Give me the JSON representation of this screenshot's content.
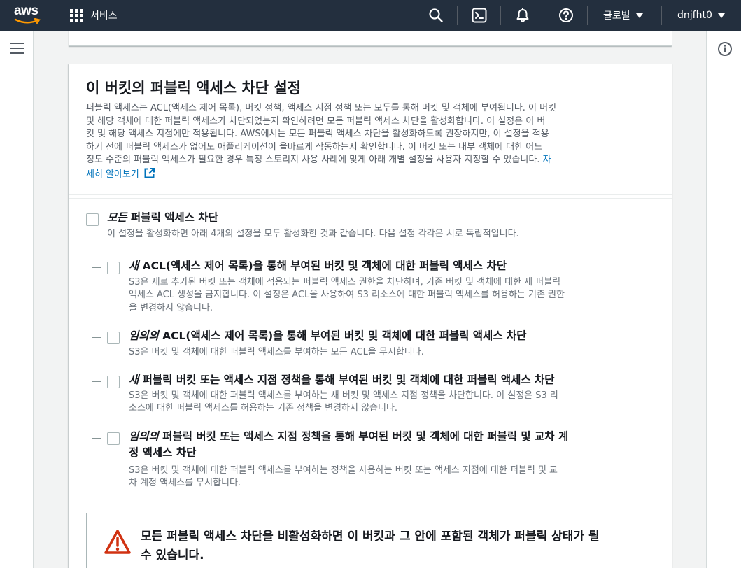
{
  "topnav": {
    "logo_text": "aws",
    "services_label": "서비스",
    "region_label": "글로벌",
    "account_label": "dnjfht0"
  },
  "colors": {
    "nav_bg": "#232f3e",
    "accent_orange": "#ff9900",
    "link": "#0073bb",
    "warning_red": "#d13212"
  },
  "section": {
    "title": "이 버킷의 퍼블릭 액세스 차단 설정",
    "desc_lines": [
      "퍼블릭 액세스는 ACL(액세스 제어 목록), 버킷 정책, 액세스 지점 정책 또는 모두를 통해 버킷 및 객체에 부여됩니다. 이 버킷",
      "및 해당 객체에 대한 퍼블릭 액세스가 차단되었는지 확인하려면 모든 퍼블릭 액세스 차단을 활성화합니다. 이 설정은 이 버",
      "킷 및 해당 액세스 지점에만 적용됩니다. AWS에서는 모든 퍼블릭 액세스 차단을 활성화하도록 권장하지만, 이 설정을 적용",
      "하기 전에 퍼블릭 액세스가 없어도 애플리케이션이 올바르게 작동하는지 확인합니다. 이 버킷 또는 내부 객체에 대한 어느",
      "정도 수준의 퍼블릭 액세스가 필요한 경우 특정 스토리지 사용 사례에 맞게 아래 개별 설정을 사용자 지정할 수 있습니다."
    ],
    "link_part1": " 자",
    "link_part2": "세히 알아보기"
  },
  "options": [
    {
      "emph": "모든",
      "title": " 퍼블릭 액세스 차단",
      "title2": "",
      "desc": [
        "이 설정을 활성화하면 아래 4개의 설정을 모두 활성화한 것과 같습니다. 다음 설정 각각은 서로 독립적입니다."
      ],
      "checked": false
    },
    {
      "emph": "새",
      "title": " ACL(액세스 제어 목록)을 통해 부여된 버킷 및 객체에 대한 퍼블릭 액세스 차단",
      "title2": "",
      "desc": [
        "S3은 새로 추가된 버킷 또는 객체에 적용되는 퍼블릭 액세스 권한을 차단하며, 기존 버킷 및 객체에 대한 새 퍼블릭",
        "액세스 ACL 생성을 금지합니다. 이 설정은 ACL을 사용하여 S3 리소스에 대한 퍼블릭 액세스를 허용하는 기존 권한",
        "을 변경하지 않습니다."
      ],
      "checked": false
    },
    {
      "emph": "임의의",
      "title": " ACL(액세스 제어 목록)을 통해 부여된 버킷 및 객체에 대한 퍼블릭 액세스 차단",
      "title2": "",
      "desc": [
        "S3은 버킷 및 객체에 대한 퍼블릭 액세스를 부여하는 모든 ACL을 무시합니다."
      ],
      "checked": false
    },
    {
      "emph": "새",
      "title": " 퍼블릭 버킷 또는 액세스 지점 정책을 통해 부여된 버킷 및 객체에 대한 퍼블릭 액세스 차단",
      "title2": "",
      "desc": [
        "S3은 버킷 및 객체에 대한 퍼블릭 액세스를 부여하는 새 버킷 및 액세스 지점 정책을 차단합니다. 이 설정은 S3 리",
        "소스에 대한 퍼블릭 액세스를 허용하는 기존 정책을 변경하지 않습니다."
      ],
      "checked": false
    },
    {
      "emph": "임의의",
      "title": " 퍼블릭 버킷 또는 액세스 지점 정책을 통해 부여된 버킷 및 객체에 대한 퍼블릭 및 교차 계",
      "title2": "정 액세스 차단",
      "desc": [
        "S3은 버킷 및 객체에 대한 퍼블릭 액세스를 부여하는 정책을 사용하는 버킷 또는 액세스 지점에 대한 퍼블릭 및 교",
        "차 계정 액세스를 무시합니다."
      ],
      "checked": false
    }
  ],
  "warning": {
    "line1": "모든 퍼블릭 액세스 차단을 비활성화하면 이 버킷과 그 안에 포함된 객체가 퍼블릭 상태가 될",
    "line2": "수 있습니다."
  },
  "icons": [
    "grid-icon",
    "search-icon",
    "cloudshell-icon",
    "bell-icon",
    "help-icon",
    "menu-icon",
    "info-icon",
    "external-link-icon",
    "warning-icon"
  ]
}
